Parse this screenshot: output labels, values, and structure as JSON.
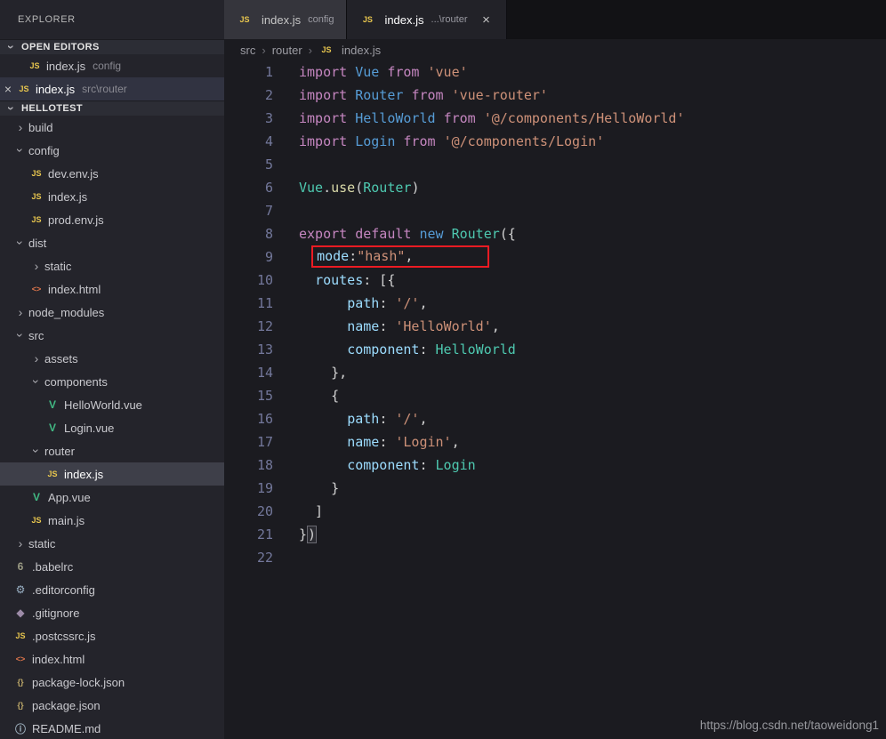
{
  "explorer": {
    "title": "EXPLORER",
    "open_editors_header": "OPEN EDITORS",
    "project_header": "HELLOTEST",
    "open_editors": [
      {
        "icon": "js",
        "label": "index.js",
        "detail": "config",
        "close": false,
        "selected": false
      },
      {
        "icon": "js",
        "label": "index.js",
        "detail": "src\\router",
        "close": true,
        "selected": true
      }
    ],
    "tree": [
      {
        "indent": 0,
        "chevron": "right",
        "label": "build"
      },
      {
        "indent": 0,
        "chevron": "down",
        "label": "config"
      },
      {
        "indent": 1,
        "icon": "js",
        "label": "dev.env.js"
      },
      {
        "indent": 1,
        "icon": "js",
        "label": "index.js"
      },
      {
        "indent": 1,
        "icon": "js",
        "label": "prod.env.js"
      },
      {
        "indent": 0,
        "chevron": "down",
        "label": "dist"
      },
      {
        "indent": 1,
        "chevron": "right",
        "label": "static"
      },
      {
        "indent": 1,
        "icon": "html",
        "label": "index.html"
      },
      {
        "indent": 0,
        "chevron": "right",
        "label": "node_modules"
      },
      {
        "indent": 0,
        "chevron": "down",
        "label": "src"
      },
      {
        "indent": 1,
        "chevron": "right",
        "label": "assets"
      },
      {
        "indent": 1,
        "chevron": "down",
        "label": "components"
      },
      {
        "indent": 2,
        "icon": "vue",
        "label": "HelloWorld.vue"
      },
      {
        "indent": 2,
        "icon": "vue",
        "label": "Login.vue"
      },
      {
        "indent": 1,
        "chevron": "down",
        "label": "router"
      },
      {
        "indent": 2,
        "icon": "js",
        "label": "index.js",
        "selected": true
      },
      {
        "indent": 1,
        "icon": "vue",
        "label": "App.vue"
      },
      {
        "indent": 1,
        "icon": "js",
        "label": "main.js"
      },
      {
        "indent": 0,
        "chevron": "right",
        "label": "static"
      },
      {
        "indent": 0,
        "icon": "babel",
        "label": ".babelrc"
      },
      {
        "indent": 0,
        "icon": "gear",
        "label": ".editorconfig"
      },
      {
        "indent": 0,
        "icon": "git",
        "label": ".gitignore"
      },
      {
        "indent": 0,
        "icon": "js",
        "label": ".postcssrc.js"
      },
      {
        "indent": 0,
        "icon": "html",
        "label": "index.html"
      },
      {
        "indent": 0,
        "icon": "json",
        "label": "package-lock.json"
      },
      {
        "indent": 0,
        "icon": "json",
        "label": "package.json"
      },
      {
        "indent": 0,
        "icon": "info",
        "label": "README.md"
      }
    ]
  },
  "tabs": [
    {
      "icon": "js",
      "label": "index.js",
      "detail": "config",
      "active": false,
      "close": false
    },
    {
      "icon": "js",
      "label": "index.js",
      "detail": "...\\router",
      "active": true,
      "close": true
    }
  ],
  "breadcrumb": {
    "crumbs": [
      "src",
      "router"
    ],
    "file": {
      "icon": "js",
      "label": "index.js"
    }
  },
  "icons": {
    "js": {
      "glyph": "JS",
      "color": "#e8c64e"
    },
    "vue": {
      "glyph": "V",
      "color": "#41b883"
    },
    "html": {
      "glyph": "<>",
      "color": "#e0764c"
    },
    "babel": {
      "glyph": "6",
      "color": "#9b9b84"
    },
    "gear": {
      "glyph": "⚙",
      "color": "#99b0c4"
    },
    "git": {
      "glyph": "◆",
      "color": "#9d8ba8"
    },
    "json": {
      "glyph": "{}",
      "color": "#c0ab6a"
    },
    "info": {
      "glyph": "ⓘ",
      "color": "#9fb2c0"
    }
  },
  "token_colors": {
    "kw": "#c586c0",
    "kw2": "#569cd6",
    "imp": "#569cd6",
    "cls": "#4ec9b0",
    "fn": "#dcdcaa",
    "prop": "#9cdcfe",
    "str": "#ce9178",
    "def": "#d4d4d4"
  },
  "editor": {
    "highlight": {
      "line": 9,
      "color": "#ed1b23"
    },
    "lines": [
      {
        "segments": [
          [
            "import ",
            "kw"
          ],
          [
            "Vue",
            "imp"
          ],
          [
            " ",
            "def"
          ],
          [
            "from",
            "kw"
          ],
          [
            " ",
            "def"
          ],
          [
            "'vue'",
            "str"
          ]
        ]
      },
      {
        "segments": [
          [
            "import ",
            "kw"
          ],
          [
            "Router",
            "imp"
          ],
          [
            " ",
            "def"
          ],
          [
            "from",
            "kw"
          ],
          [
            " ",
            "def"
          ],
          [
            "'vue-router'",
            "str"
          ]
        ]
      },
      {
        "segments": [
          [
            "import ",
            "kw"
          ],
          [
            "HelloWorld",
            "imp"
          ],
          [
            " ",
            "def"
          ],
          [
            "from",
            "kw"
          ],
          [
            " ",
            "def"
          ],
          [
            "'@/components/HelloWorld'",
            "str"
          ]
        ]
      },
      {
        "segments": [
          [
            "import ",
            "kw"
          ],
          [
            "Login",
            "imp"
          ],
          [
            " ",
            "def"
          ],
          [
            "from",
            "kw"
          ],
          [
            " ",
            "def"
          ],
          [
            "'@/components/Login'",
            "str"
          ]
        ]
      },
      {
        "segments": []
      },
      {
        "segments": [
          [
            "Vue",
            "cls"
          ],
          [
            ".",
            "def"
          ],
          [
            "use",
            "fn"
          ],
          [
            "(",
            "def"
          ],
          [
            "Router",
            "cls"
          ],
          [
            ")",
            "def"
          ]
        ]
      },
      {
        "segments": []
      },
      {
        "segments": [
          [
            "export",
            "kw"
          ],
          [
            " ",
            "def"
          ],
          [
            "default",
            "kw"
          ],
          [
            " ",
            "def"
          ],
          [
            "new",
            "kw2"
          ],
          [
            " ",
            "def"
          ],
          [
            "Router",
            "cls"
          ],
          [
            "({",
            "def"
          ]
        ]
      },
      {
        "box_from": 1,
        "segments": [
          [
            "  ",
            "def"
          ],
          [
            "mode",
            "prop"
          ],
          [
            ":",
            "def"
          ],
          [
            "\"hash\"",
            "str"
          ],
          [
            ",",
            "def"
          ]
        ]
      },
      {
        "segments": [
          [
            "  ",
            "def"
          ],
          [
            "routes",
            "prop"
          ],
          [
            ": [{",
            "def"
          ]
        ]
      },
      {
        "segments": [
          [
            "      ",
            "def"
          ],
          [
            "path",
            "prop"
          ],
          [
            ": ",
            "def"
          ],
          [
            "'/'",
            "str"
          ],
          [
            ",",
            "def"
          ]
        ]
      },
      {
        "segments": [
          [
            "      ",
            "def"
          ],
          [
            "name",
            "prop"
          ],
          [
            ": ",
            "def"
          ],
          [
            "'HelloWorld'",
            "str"
          ],
          [
            ",",
            "def"
          ]
        ]
      },
      {
        "segments": [
          [
            "      ",
            "def"
          ],
          [
            "component",
            "prop"
          ],
          [
            ": ",
            "def"
          ],
          [
            "HelloWorld",
            "cls"
          ]
        ]
      },
      {
        "segments": [
          [
            "    },",
            "def"
          ]
        ]
      },
      {
        "segments": [
          [
            "    {",
            "def"
          ]
        ]
      },
      {
        "segments": [
          [
            "      ",
            "def"
          ],
          [
            "path",
            "prop"
          ],
          [
            ": ",
            "def"
          ],
          [
            "'/'",
            "str"
          ],
          [
            ",",
            "def"
          ]
        ]
      },
      {
        "segments": [
          [
            "      ",
            "def"
          ],
          [
            "name",
            "prop"
          ],
          [
            ": ",
            "def"
          ],
          [
            "'Login'",
            "str"
          ],
          [
            ",",
            "def"
          ]
        ]
      },
      {
        "segments": [
          [
            "      ",
            "def"
          ],
          [
            "component",
            "prop"
          ],
          [
            ": ",
            "def"
          ],
          [
            "Login",
            "cls"
          ]
        ]
      },
      {
        "segments": [
          [
            "    }",
            "def"
          ]
        ]
      },
      {
        "segments": [
          [
            "  ]",
            "def"
          ]
        ]
      },
      {
        "segments": [
          [
            "}",
            "def"
          ],
          [
            ")",
            "def",
            "match"
          ]
        ]
      },
      {
        "segments": []
      }
    ]
  },
  "watermark": "https://blog.csdn.net/taoweidong1"
}
